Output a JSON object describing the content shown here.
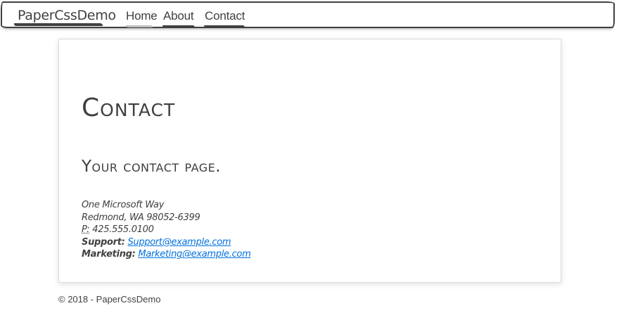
{
  "navbar": {
    "brand": "PaperCssDemo",
    "items": [
      {
        "label": "Home"
      },
      {
        "label": "About"
      },
      {
        "label": "Contact"
      }
    ]
  },
  "page": {
    "title": "Contact",
    "subtitle": "Your contact page."
  },
  "address": {
    "street": "One Microsoft Way",
    "city": "Redmond, WA 98052-6399",
    "phone_abbr": "P:",
    "phone": "425.555.0100",
    "support_label": "Support:",
    "support_email": "Support@example.com",
    "marketing_label": "Marketing:",
    "marketing_email": "Marketing@example.com"
  },
  "footer": {
    "text": "© 2018 - PaperCssDemo"
  },
  "colors": {
    "text": "#41403e",
    "link": "#0071de",
    "card_border": "#dcdcdc"
  }
}
